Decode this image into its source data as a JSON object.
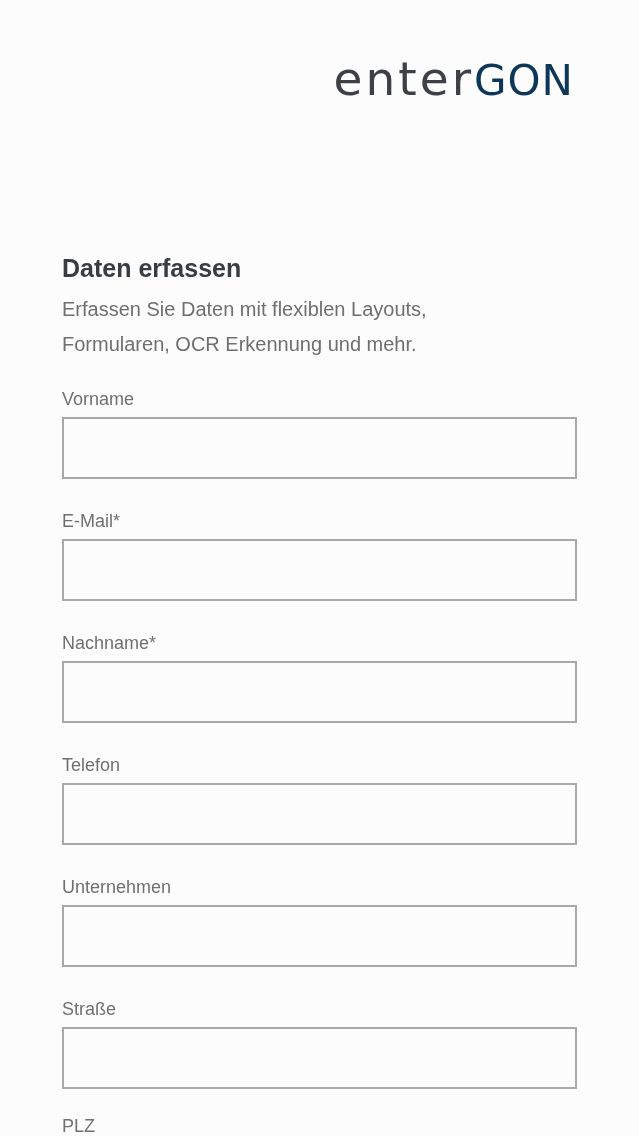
{
  "logo": {
    "text": "enter",
    "accent": "GON"
  },
  "heading": "Daten erfassen",
  "description": "Erfassen Sie Daten mit flexiblen Layouts, Formularen, OCR Erkennung und mehr.",
  "fields": [
    {
      "label": "Vorname"
    },
    {
      "label": "E-Mail*"
    },
    {
      "label": "Nachname*"
    },
    {
      "label": "Telefon"
    },
    {
      "label": "Unternehmen"
    },
    {
      "label": "Straße"
    }
  ],
  "partial_field": {
    "label": "PLZ"
  }
}
